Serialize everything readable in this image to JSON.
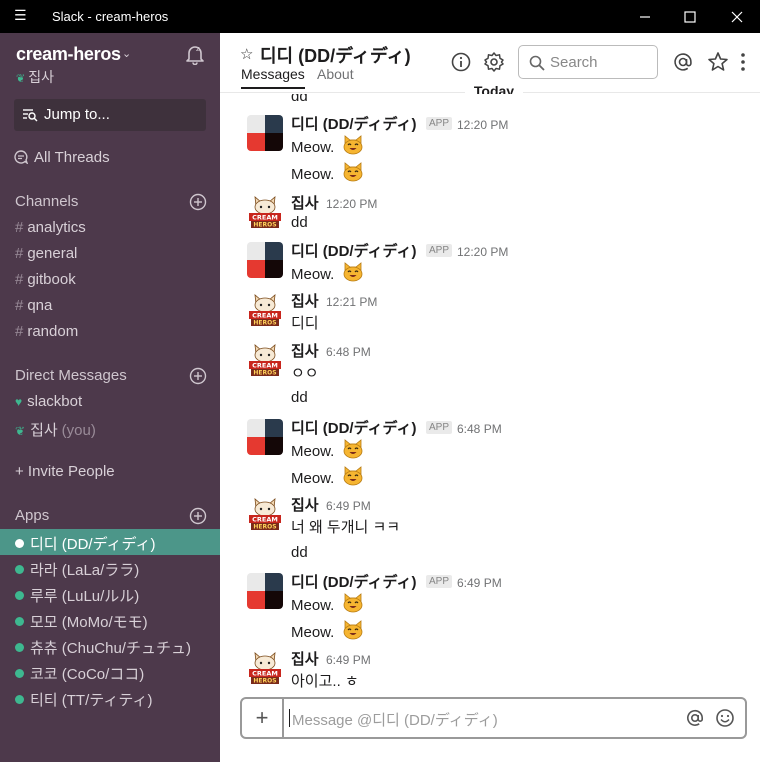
{
  "window": {
    "title": "Slack - cream-heros",
    "menu_icon": "hamburger-menu-icon",
    "minimize_icon": "minimize-icon",
    "maximize_icon": "maximize-icon",
    "close_icon": "close-icon"
  },
  "sidebar": {
    "workspace_name": "cream-heros",
    "user_name": "집사",
    "jump_to": "Jump to...",
    "all_threads": "All Threads",
    "channels_header": "Channels",
    "channels": [
      {
        "name": "analytics"
      },
      {
        "name": "general"
      },
      {
        "name": "gitbook"
      },
      {
        "name": "qna"
      },
      {
        "name": "random"
      }
    ],
    "dm_header": "Direct Messages",
    "dms": [
      {
        "name": "slackbot",
        "suffix": ""
      },
      {
        "name": "집사",
        "suffix": "(you)"
      }
    ],
    "invite_people": "+ Invite People",
    "apps_header": "Apps",
    "apps": [
      {
        "name": "디디 (DD/ディディ)",
        "active": true
      },
      {
        "name": "라라 (LaLa/ララ)",
        "active": false
      },
      {
        "name": "루루 (LuLu/ルル)",
        "active": false
      },
      {
        "name": "모모 (MoMo/モモ)",
        "active": false
      },
      {
        "name": "츄츄 (ChuChu/チュチュ)",
        "active": false
      },
      {
        "name": "코코 (CoCo/ココ)",
        "active": false
      },
      {
        "name": "티티 (TT/ティティ)",
        "active": false
      }
    ],
    "colors": {
      "background": "#4d394b",
      "active": "#4c9689",
      "presence": "#3eb890"
    }
  },
  "header": {
    "channel_name": "디디 (DD/ディディ)",
    "tabs": [
      {
        "label": "Messages",
        "active": true
      },
      {
        "label": "About",
        "active": false
      }
    ],
    "search_placeholder": "Search"
  },
  "messages": {
    "day_divider": "Today",
    "app_badge": "APP",
    "top_partial_text": "dd",
    "groups": [
      {
        "sender": "디디 (DD/ディディ)",
        "is_app": true,
        "time": "12:20 PM",
        "lines": [
          "Meow.",
          "Meow."
        ]
      },
      {
        "sender": "집사",
        "is_app": false,
        "time": "12:20 PM",
        "lines": [
          "dd"
        ]
      },
      {
        "sender": "디디 (DD/ディディ)",
        "is_app": true,
        "time": "12:20 PM",
        "lines": [
          "Meow."
        ]
      },
      {
        "sender": "집사",
        "is_app": false,
        "time": "12:21 PM",
        "lines": [
          "디디"
        ]
      },
      {
        "sender": "집사",
        "is_app": false,
        "time": "6:48 PM",
        "lines": [
          "ㅇㅇ",
          "dd"
        ]
      },
      {
        "sender": "디디 (DD/ディディ)",
        "is_app": true,
        "time": "6:48 PM",
        "lines": [
          "Meow.",
          "Meow."
        ]
      },
      {
        "sender": "집사",
        "is_app": false,
        "time": "6:49 PM",
        "lines": [
          "너 왜 두개니 ㅋㅋ",
          "dd"
        ]
      },
      {
        "sender": "디디 (DD/ディディ)",
        "is_app": true,
        "time": "6:49 PM",
        "lines": [
          "Meow.",
          "Meow."
        ]
      },
      {
        "sender": "집사",
        "is_app": false,
        "time": "6:49 PM",
        "lines": [
          "아이고.. ㅎ"
        ]
      }
    ]
  },
  "composer": {
    "placeholder": "Message @디디 (DD/ディディ)"
  }
}
